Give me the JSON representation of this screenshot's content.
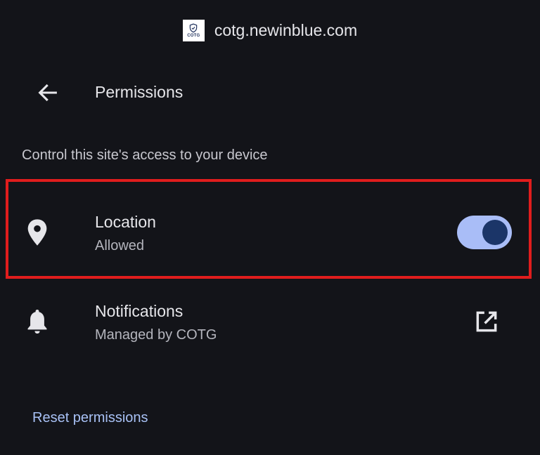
{
  "site": {
    "url": "cotg.newinblue.com",
    "logo_text": "COTG",
    "logo_icon": "shield-icon"
  },
  "header": {
    "back_icon": "arrow-left-icon",
    "title": "Permissions"
  },
  "section": {
    "description": "Control this site's access to your device"
  },
  "permissions": [
    {
      "title": "Location",
      "status": "Allowed",
      "icon": "location-pin-icon",
      "control": "toggle",
      "enabled": true
    },
    {
      "title": "Notifications",
      "status": "Managed by COTG",
      "icon": "bell-icon",
      "control": "external-link-icon"
    }
  ],
  "actions": {
    "reset_label": "Reset permissions"
  },
  "colors": {
    "background": "#131419",
    "text_primary": "#e6e6ea",
    "text_secondary": "#b4b5bd",
    "accent": "#a8c1f5",
    "toggle_track": "#a9bdf7",
    "toggle_knob": "#1b3568",
    "highlight": "#e01d1d"
  }
}
